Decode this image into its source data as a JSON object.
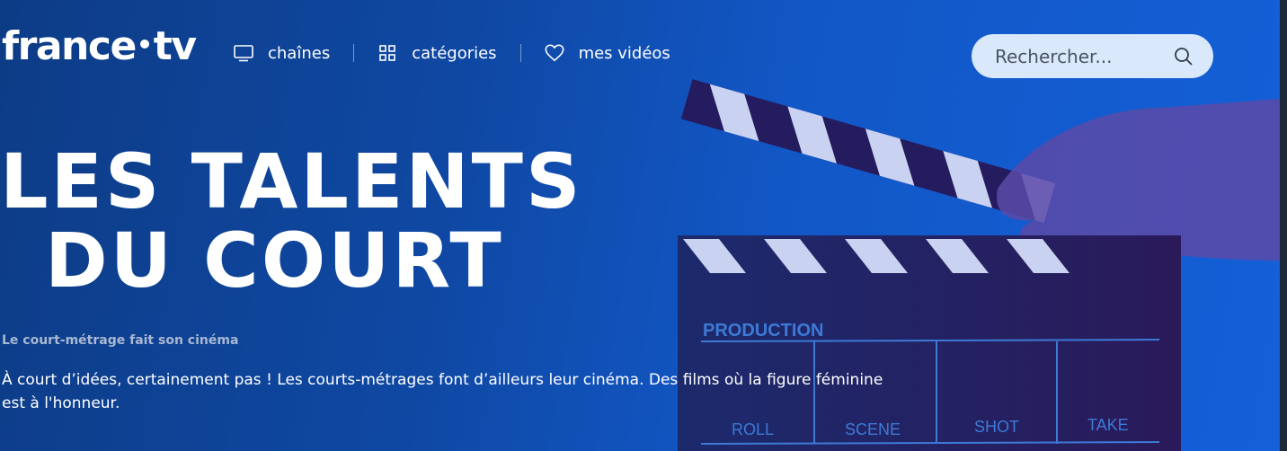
{
  "header": {
    "logo_left": "france",
    "logo_right": "tv",
    "nav": [
      {
        "label": "chaînes",
        "icon": "tv-icon"
      },
      {
        "label": "catégories",
        "icon": "grid-icon"
      },
      {
        "label": "mes vidéos",
        "icon": "heart-icon"
      }
    ],
    "search": {
      "placeholder": "Rechercher...",
      "icon": "search-icon"
    }
  },
  "hero": {
    "title_line1": "LES TALENTS",
    "title_line2": "DU COURT",
    "subtitle": "Le court-métrage fait son cinéma",
    "description": "À court d’idées, certainement pas ! Les courts-métrages font d’ailleurs leur cinéma. Des films où la figure féminine est à l'honneur.",
    "clapperboard": {
      "production": "PRODUCTION",
      "columns": [
        "ROLL",
        "SCENE",
        "SHOT",
        "TAKE"
      ]
    }
  },
  "colors": {
    "hero_blue": "#1257c6",
    "search_bg": "#d9e8fb",
    "board_dark": "#221b54"
  }
}
